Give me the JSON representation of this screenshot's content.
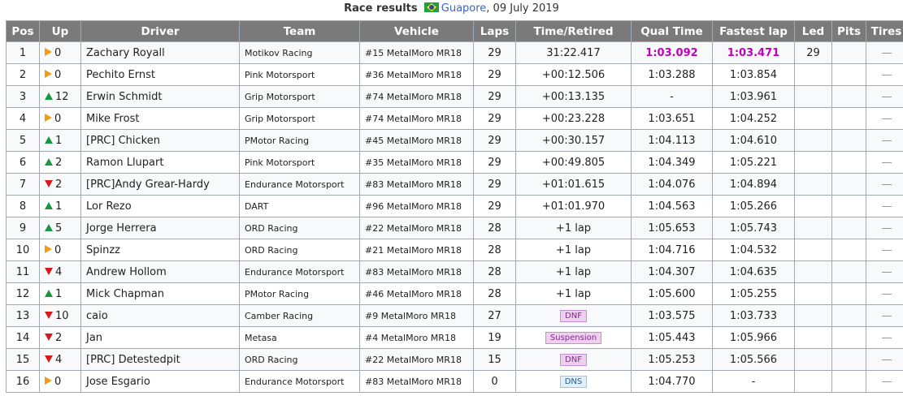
{
  "caption": {
    "title": "Race results",
    "flag": "brazil-flag",
    "track": "Guapore",
    "date": ", 09 July 2019"
  },
  "headers": [
    "Pos",
    "Up",
    "Driver",
    "Team",
    "Vehicle",
    "Laps",
    "Time/Retired",
    "Qual Time",
    "Fastest lap",
    "Led",
    "Pits",
    "Tires"
  ],
  "rows": [
    {
      "pos": "1",
      "dir": "same",
      "up": "0",
      "driver": "Zachary Royall",
      "team": "Motikov Racing",
      "vehicle": "#15 MetalMoro MR18",
      "laps": "29",
      "time": "31:22.417",
      "qual": "1:03.092",
      "fastest": "1:03.471",
      "led": "29",
      "pits": ""
    },
    {
      "pos": "2",
      "dir": "same",
      "up": "0",
      "driver": "Pechito Ernst",
      "team": "Pink Motorsport",
      "vehicle": "#36 MetalMoro MR18",
      "laps": "29",
      "time": "+00:12.506",
      "qual": "1:03.288",
      "fastest": "1:03.854",
      "led": "",
      "pits": ""
    },
    {
      "pos": "3",
      "dir": "gain",
      "up": "12",
      "driver": "Erwin Schmidt",
      "team": "Grip Motorsport",
      "vehicle": "#74 MetalMoro MR18",
      "laps": "29",
      "time": "+00:13.135",
      "qual": "-",
      "fastest": "1:03.961",
      "led": "",
      "pits": ""
    },
    {
      "pos": "4",
      "dir": "same",
      "up": "0",
      "driver": "Mike Frost",
      "team": "Grip Motorsport",
      "vehicle": "#74 MetalMoro MR18",
      "laps": "29",
      "time": "+00:23.228",
      "qual": "1:03.651",
      "fastest": "1:04.252",
      "led": "",
      "pits": ""
    },
    {
      "pos": "5",
      "dir": "gain",
      "up": "1",
      "driver": "[PRC] Chicken",
      "team": "PMotor Racing",
      "vehicle": "#45 MetalMoro MR18",
      "laps": "29",
      "time": "+00:30.157",
      "qual": "1:04.113",
      "fastest": "1:04.610",
      "led": "",
      "pits": ""
    },
    {
      "pos": "6",
      "dir": "gain",
      "up": "2",
      "driver": "Ramon Llupart",
      "team": "Pink Motorsport",
      "vehicle": "#35 MetalMoro MR18",
      "laps": "29",
      "time": "+00:49.805",
      "qual": "1:04.349",
      "fastest": "1:05.221",
      "led": "",
      "pits": ""
    },
    {
      "pos": "7",
      "dir": "loss",
      "up": "2",
      "driver": "[PRC]Andy Grear-Hardy",
      "team": "Endurance Motorsport",
      "vehicle": "#83 MetalMoro MR18",
      "laps": "29",
      "time": "+01:01.615",
      "qual": "1:04.076",
      "fastest": "1:04.894",
      "led": "",
      "pits": ""
    },
    {
      "pos": "8",
      "dir": "gain",
      "up": "1",
      "driver": "Lor Rezo",
      "team": "DART",
      "vehicle": "#96 MetalMoro MR18",
      "laps": "29",
      "time": "+01:01.970",
      "qual": "1:04.563",
      "fastest": "1:05.266",
      "led": "",
      "pits": ""
    },
    {
      "pos": "9",
      "dir": "gain",
      "up": "5",
      "driver": "Jorge Herrera",
      "team": "ORD Racing",
      "vehicle": "#22 MetalMoro MR18",
      "laps": "28",
      "time": "+1 lap",
      "qual": "1:05.653",
      "fastest": "1:05.743",
      "led": "",
      "pits": ""
    },
    {
      "pos": "10",
      "dir": "same",
      "up": "0",
      "driver": "Spinzz",
      "team": "ORD Racing",
      "vehicle": "#21 MetalMoro MR18",
      "laps": "28",
      "time": "+1 lap",
      "qual": "1:04.716",
      "fastest": "1:04.532",
      "led": "",
      "pits": ""
    },
    {
      "pos": "11",
      "dir": "loss",
      "up": "4",
      "driver": "Andrew Hollom",
      "team": "Endurance Motorsport",
      "vehicle": "#83 MetalMoro MR18",
      "laps": "28",
      "time": "+1 lap",
      "qual": "1:04.307",
      "fastest": "1:04.635",
      "led": "",
      "pits": ""
    },
    {
      "pos": "12",
      "dir": "gain",
      "up": "1",
      "driver": "Mick Chapman",
      "team": "PMotor Racing",
      "vehicle": "#46 MetalMoro MR18",
      "laps": "28",
      "time": "+1 lap",
      "qual": "1:05.600",
      "fastest": "1:05.255",
      "led": "",
      "pits": ""
    },
    {
      "pos": "13",
      "dir": "loss",
      "up": "10",
      "driver": "caio",
      "team": "Camber Racing",
      "vehicle": "#9 MetalMoro MR18",
      "laps": "27",
      "time": "DNF",
      "badge": "dnf",
      "qual": "1:03.575",
      "fastest": "1:03.733",
      "led": "",
      "pits": ""
    },
    {
      "pos": "14",
      "dir": "loss",
      "up": "2",
      "driver": "Jan",
      "team": "Metasa",
      "vehicle": "#4 MetalMoro MR18",
      "laps": "19",
      "time": "Suspension",
      "badge": "dnf",
      "qual": "1:05.443",
      "fastest": "1:05.966",
      "led": "",
      "pits": ""
    },
    {
      "pos": "15",
      "dir": "loss",
      "up": "4",
      "driver": "[PRC] Detestedpit",
      "team": "ORD Racing",
      "vehicle": "#22 MetalMoro MR18",
      "laps": "15",
      "time": "DNF",
      "badge": "dnf",
      "qual": "1:05.253",
      "fastest": "1:05.566",
      "led": "",
      "pits": ""
    },
    {
      "pos": "16",
      "dir": "same",
      "up": "0",
      "driver": "Jose Esgario",
      "team": "Endurance Motorsport",
      "vehicle": "#83 MetalMoro MR18",
      "laps": "0",
      "time": "DNS",
      "badge": "dns",
      "qual": "1:04.770",
      "fastest": "-",
      "led": "",
      "pits": ""
    }
  ],
  "highlight_color": "#c000c0"
}
